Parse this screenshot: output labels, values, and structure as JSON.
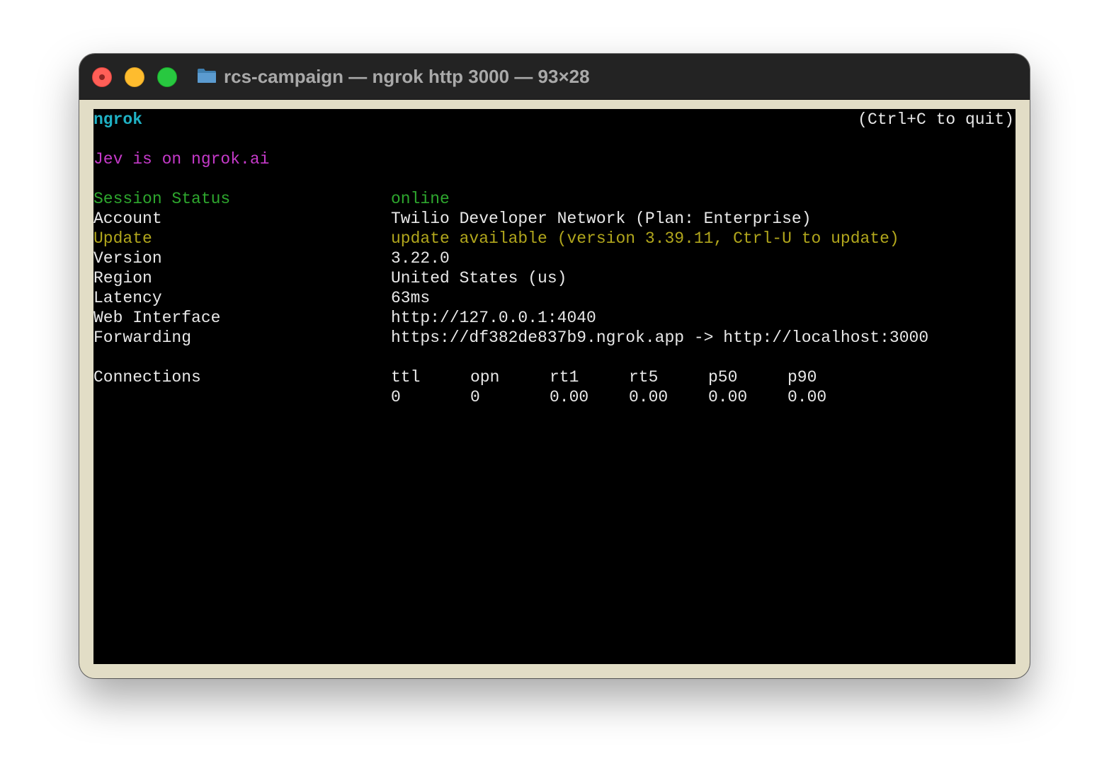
{
  "window": {
    "title": "rcs-campaign — ngrok http 3000 — 93×28",
    "icon": "folder-icon"
  },
  "terminal": {
    "app_name": "ngrok",
    "quit_hint": "(Ctrl+C to quit)",
    "banner": "Jev is on ngrok.ai",
    "rows": [
      {
        "label": "Session Status",
        "value": "online",
        "color": "#2ea72e"
      },
      {
        "label": "Account",
        "value": "Twilio Developer Network (Plan: Enterprise)",
        "color": "#e8e8e8"
      },
      {
        "label": "Update",
        "value": "update available (version 3.39.11, Ctrl-U to update)",
        "color": "#b1a61c"
      },
      {
        "label": "Version",
        "value": "3.22.0",
        "color": "#e8e8e8"
      },
      {
        "label": "Region",
        "value": "United States (us)",
        "color": "#e8e8e8"
      },
      {
        "label": "Latency",
        "value": "63ms",
        "color": "#e8e8e8"
      },
      {
        "label": "Web Interface",
        "value": "http://127.0.0.1:4040",
        "color": "#e8e8e8"
      },
      {
        "label": "Forwarding",
        "value": "https://df382de837b9.ngrok.app -> http://localhost:3000",
        "color": "#e8e8e8"
      }
    ],
    "connections": {
      "label": "Connections",
      "headers": [
        "ttl",
        "opn",
        "rt1",
        "rt5",
        "p50",
        "p90"
      ],
      "values": [
        "0",
        "0",
        "0.00",
        "0.00",
        "0.00",
        "0.00"
      ]
    }
  },
  "colors": {
    "ngrok_cyan": "#1fb1c4",
    "banner_magenta": "#c53ac9",
    "status_green": "#2ea72e",
    "update_yellow": "#b1a61c",
    "terminal_bg": "#000000",
    "window_frame": "#e2ddc6"
  }
}
